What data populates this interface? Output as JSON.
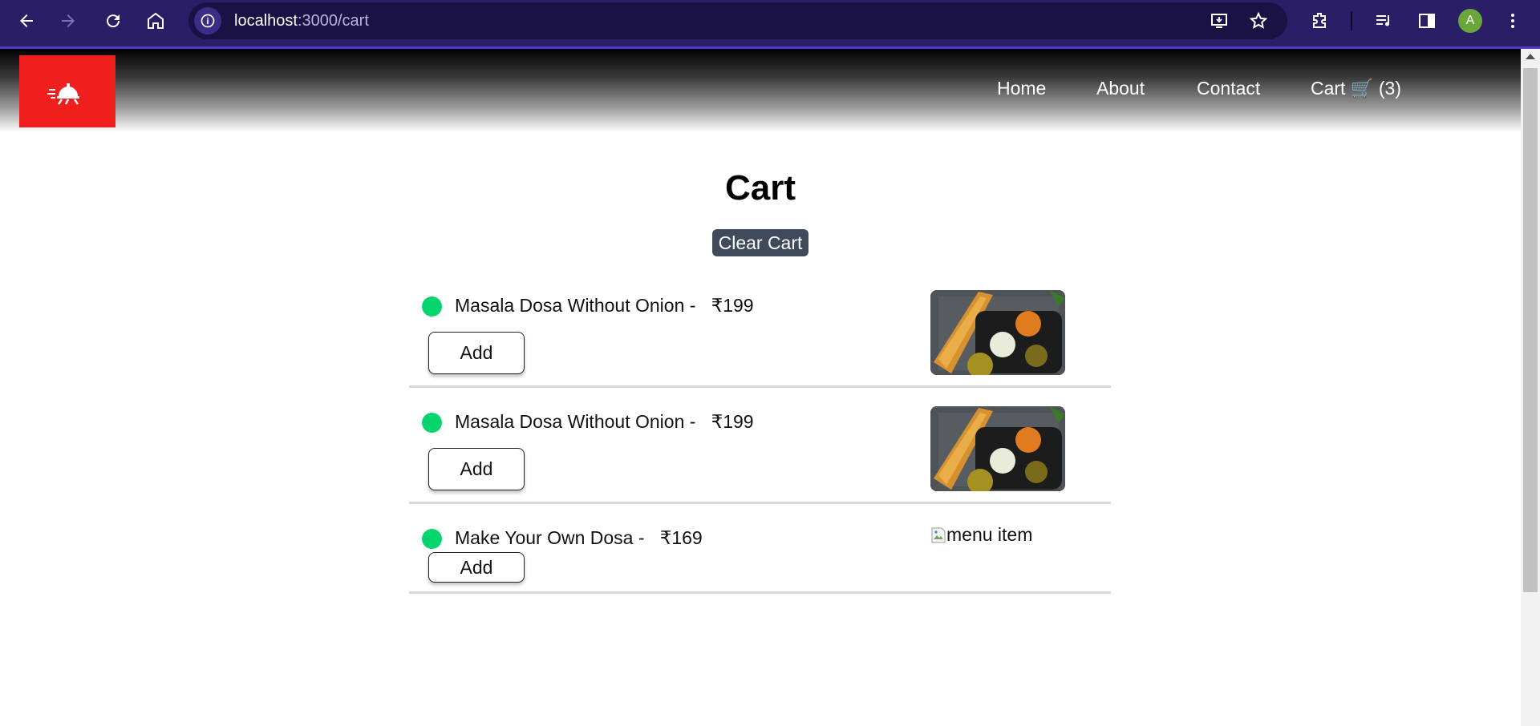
{
  "browser": {
    "url_host": "localhost",
    "url_path": ":3000/cart",
    "avatar_letter": "A",
    "colors": {
      "toolbar": "#2a1f66",
      "omnibox": "#1a1245"
    }
  },
  "header": {
    "logo_icon": "food-delivery-icon",
    "nav": {
      "home": "Home",
      "about": "About",
      "contact": "Contact",
      "cart": "Cart 🛒 (3)"
    },
    "colors": {
      "logo_bg": "#f11e1e"
    }
  },
  "cart": {
    "title": "Cart",
    "clear_label": "Clear Cart",
    "items": [
      {
        "name": "Masala Dosa Without Onion -",
        "price": "₹199",
        "add_label": "Add",
        "image": "masala-dosa-photo"
      },
      {
        "name": "Masala Dosa Without Onion -",
        "price": "₹199",
        "add_label": "Add",
        "image": "masala-dosa-photo"
      },
      {
        "name": "Make Your Own Dosa -",
        "price": "₹169",
        "add_label": "Add",
        "image_alt": "menu item"
      }
    ],
    "colors": {
      "veg_dot": "#06d46c",
      "clear_btn": "#3f4a5a"
    }
  }
}
